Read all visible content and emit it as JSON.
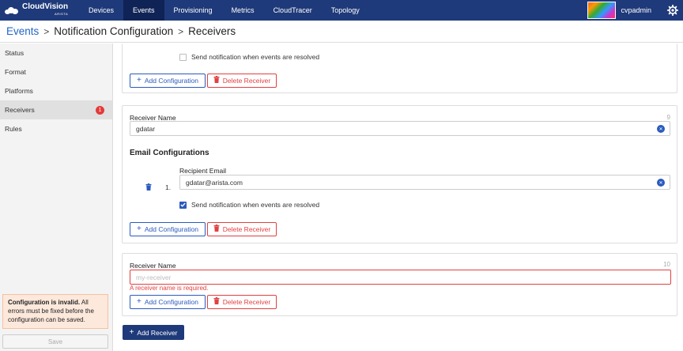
{
  "app": {
    "brand": "CloudVision",
    "brand_sub": "ARISTA"
  },
  "nav": {
    "items": [
      {
        "label": "Devices"
      },
      {
        "label": "Events"
      },
      {
        "label": "Provisioning"
      },
      {
        "label": "Metrics"
      },
      {
        "label": "CloudTracer"
      },
      {
        "label": "Topology"
      }
    ],
    "active": "Events",
    "user": "cvpadmin"
  },
  "breadcrumb": {
    "root": "Events",
    "middle": "Notification Configuration",
    "current": "Receivers",
    "separator": ">"
  },
  "sidebar": {
    "items": [
      {
        "label": "Status"
      },
      {
        "label": "Format"
      },
      {
        "label": "Platforms"
      },
      {
        "label": "Receivers",
        "badge": "1"
      },
      {
        "label": "Rules"
      }
    ],
    "error_bold": "Configuration is invalid.",
    "error_text": " All errors must be fixed before the configuration can be saved.",
    "save_label": "Save"
  },
  "receivers": {
    "card1": {
      "resolved_label": "Send notification when events are resolved",
      "add_config": "Add Configuration",
      "delete_receiver": "Delete Receiver"
    },
    "card2": {
      "name_label": "Receiver Name",
      "name_count": "9",
      "name_value": "gdatar",
      "email_section_title": "Email Configurations",
      "index": "1.",
      "recipient_label": "Recipient Email",
      "recipient_value": "gdatar@arista.com",
      "resolved_label": "Send notification when events are resolved",
      "add_config": "Add Configuration",
      "delete_receiver": "Delete Receiver"
    },
    "card3": {
      "name_label": "Receiver Name",
      "name_count": "10",
      "name_placeholder": "my-receiver",
      "error_text": "A receiver name is required.",
      "add_config": "Add Configuration",
      "delete_receiver": "Delete Receiver"
    }
  },
  "add_receiver_label": "Add Receiver",
  "colors": {
    "nav_bg": "#1f3a7a",
    "accent": "#2a5bbd",
    "danger": "#e24040"
  }
}
